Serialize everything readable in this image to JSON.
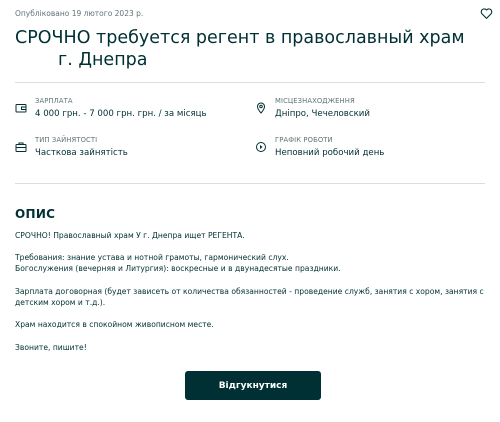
{
  "header": {
    "published": "Опубліковано 19 лютого 2023 р.",
    "title_line1": "СРОЧНО требуется регент в православный храм",
    "title_line2": "г. Днепра"
  },
  "details": [
    {
      "label": "ЗАРПЛАТА",
      "value": "4 000 грн. - 7 000 грн. грн. / за місяць",
      "icon": "wallet-icon"
    },
    {
      "label": "МІСЦЕЗНАХОДЖЕННЯ",
      "value": "Дніпро, Чечеловский",
      "icon": "location-pin-icon"
    },
    {
      "label": "ТИП ЗАЙНЯТОСТІ",
      "value": "Часткова зайнятість",
      "icon": "briefcase-icon"
    },
    {
      "label": "ГРАФІК РОБОТИ",
      "value": "Неповний робочий день",
      "icon": "clock-icon"
    }
  ],
  "description": {
    "heading": "ОПИС",
    "paragraphs": [
      "СРОЧНО! Православный храм У      г. Днепра ищет РЕГЕНТА.",
      "Требования: знание устава и нотной грамоты, гармонический слух.",
      "Богослужения (вечерняя и Литургия): воскресные и в двунадесятые праздники.",
      "Зарплата договорная (будет зависеть от количества обязанностей - проведение служб, занятия с хором, занятия с",
      "детским хором и т.д.).",
      "Храм находится в спокойном живописном месте.",
      "Звоните, пишите!"
    ]
  },
  "actions": {
    "apply_label": "Відгукнутися"
  },
  "colors": {
    "primary": "#002f34",
    "muted": "#5f7376",
    "divider": "#d8dfe0"
  }
}
